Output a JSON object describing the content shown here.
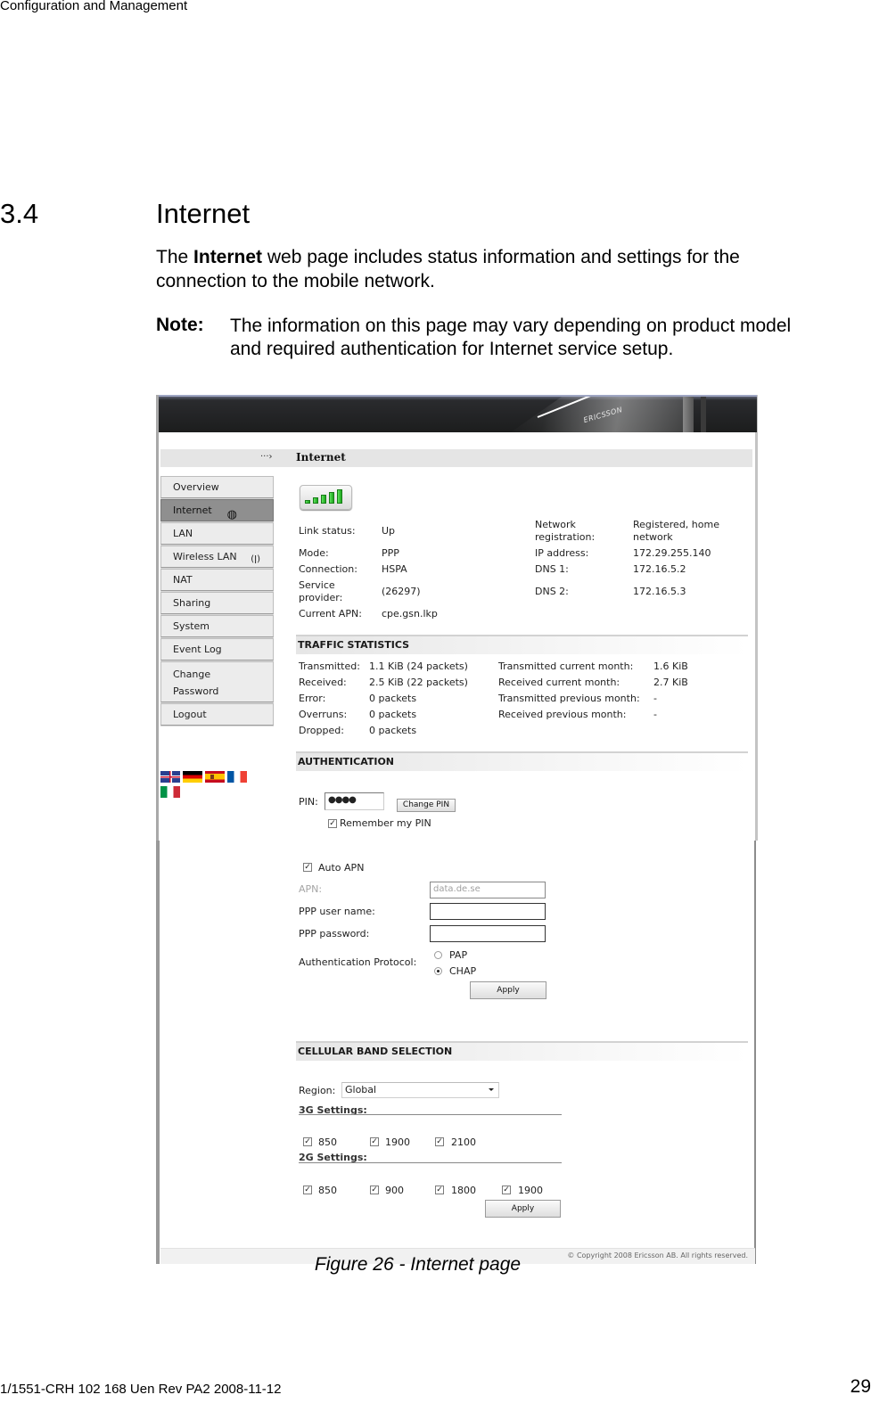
{
  "document": {
    "running_header": "Configuration and Management",
    "section_number": "3.4",
    "section_title": "Internet",
    "intro_prefix": "The ",
    "intro_bold": "Internet",
    "intro_suffix": " web page includes status information and settings for the connection to the mobile network.",
    "note_label": "Note:",
    "note_text": "The information on this page may vary depending on product model and required authentication for Internet service setup.",
    "figure_caption": "Figure 26 - Internet page",
    "footer_doc_id": "1/1551-CRH 102 168 Uen Rev PA2  2008-11-12",
    "page_number": "29"
  },
  "screenshot": {
    "banner": {
      "logo": "ERICSSON"
    },
    "breadcrumb": {
      "arrow": "···›",
      "title": "Internet"
    },
    "nav": {
      "items": [
        {
          "label": "Overview",
          "active": false
        },
        {
          "label": "Internet",
          "active": true,
          "icon": "globe-icon"
        },
        {
          "label": "LAN",
          "active": false
        },
        {
          "label": "Wireless LAN",
          "active": false,
          "icon": "wireless-icon"
        },
        {
          "label": "NAT",
          "active": false
        },
        {
          "label": "Sharing",
          "active": false
        },
        {
          "label": "System",
          "active": false
        },
        {
          "label": "Event Log",
          "active": false
        },
        {
          "label": "Change Password",
          "line1": "Change",
          "line2": "Password",
          "active": false
        },
        {
          "label": "Logout",
          "active": false
        }
      ]
    },
    "languages": [
      "English",
      "German",
      "Spanish",
      "French",
      "Italian"
    ],
    "signal": {
      "icon": "signal-strength-icon",
      "bars_filled": 5,
      "bars_total": 5
    },
    "status": {
      "left": [
        {
          "label": "Link status:",
          "value": "Up"
        },
        {
          "label": "Mode:",
          "value": "PPP"
        },
        {
          "label": "Connection:",
          "value": "HSPA"
        },
        {
          "label_line1": "Service",
          "label_line2": "provider:",
          "value": "(26297)"
        },
        {
          "label": "Current APN:",
          "value": "cpe.gsn.lkp"
        }
      ],
      "right": [
        {
          "label_line1": "Network",
          "label_line2": "registration:",
          "value_line1": "Registered, home",
          "value_line2": "network"
        },
        {
          "label": "IP address:",
          "value": "172.29.255.140"
        },
        {
          "label": "DNS 1:",
          "value": "172.16.5.2"
        },
        {
          "label": "DNS 2:",
          "value": "172.16.5.3"
        }
      ]
    },
    "traffic": {
      "heading": "TRAFFIC STATISTICS",
      "left": [
        {
          "label": "Transmitted:",
          "value": "1.1 KiB (24 packets)"
        },
        {
          "label": "Received:",
          "value": "2.5 KiB (22 packets)"
        },
        {
          "label": "Error:",
          "value": "0 packets"
        },
        {
          "label": "Overruns:",
          "value": "0 packets"
        },
        {
          "label": "Dropped:",
          "value": "0 packets"
        }
      ],
      "right": [
        {
          "label": "Transmitted current month:",
          "value": "1.6 KiB"
        },
        {
          "label": "Received current month:",
          "value": "2.7 KiB"
        },
        {
          "label": "Transmitted previous month:",
          "value": "-"
        },
        {
          "label": "Received previous month:",
          "value": "-"
        }
      ]
    },
    "authentication": {
      "heading": "AUTHENTICATION",
      "pin_label": "PIN:",
      "pin_value": "●●●●",
      "change_pin_label": "Change PIN",
      "remember_pin_label": "Remember my PIN",
      "remember_pin_checked": true,
      "auto_apn_label": "Auto APN",
      "auto_apn_checked": true,
      "apn_label": "APN:",
      "apn_value": "data.de.se",
      "ppp_user_label": "PPP user name:",
      "ppp_user_value": "",
      "ppp_password_label": "PPP password:",
      "ppp_password_value": "",
      "auth_protocol_label": "Authentication Protocol:",
      "protocols": [
        {
          "label": "PAP",
          "selected": false
        },
        {
          "label": "CHAP",
          "selected": true
        }
      ],
      "apply_label": "Apply"
    },
    "band_selection": {
      "heading": "CELLULAR BAND SELECTION",
      "region_label": "Region:",
      "region_value": "Global",
      "g3_heading": "3G Settings:",
      "g3_bands": [
        {
          "label": "850",
          "checked": true
        },
        {
          "label": "1900",
          "checked": true
        },
        {
          "label": "2100",
          "checked": true
        }
      ],
      "g2_heading": "2G Settings:",
      "g2_bands": [
        {
          "label": "850",
          "checked": true
        },
        {
          "label": "900",
          "checked": true
        },
        {
          "label": "1800",
          "checked": true
        },
        {
          "label": "1900",
          "checked": true
        }
      ],
      "apply_label": "Apply"
    },
    "copyright": "© Copyright 2008 Ericsson AB. All rights reserved."
  }
}
